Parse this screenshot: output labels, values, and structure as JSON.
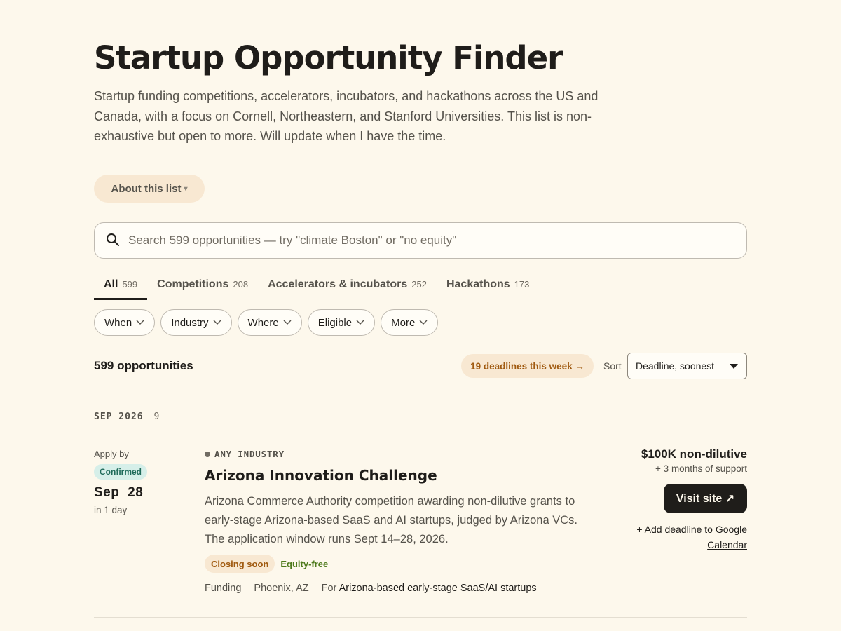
{
  "header": {
    "title": "Startup Opportunity Finder",
    "intro": "Startup funding competitions, accelerators, incubators, and hackathons across the US and Canada, with a focus on Cornell, Northeastern, and Stanford Universities. This list is non-exhaustive but open to more. Will update when I have the time.",
    "about_label": "About this list"
  },
  "search": {
    "placeholder": "Search 599 opportunities — try \"climate Boston\" or \"no equity\"",
    "value": ""
  },
  "tabs": [
    {
      "label": "All",
      "count": "599",
      "active": true
    },
    {
      "label": "Competitions",
      "count": "208",
      "active": false
    },
    {
      "label": "Accelerators & incubators",
      "count": "252",
      "active": false
    },
    {
      "label": "Hackathons",
      "count": "173",
      "active": false
    }
  ],
  "filters": [
    {
      "label": "When"
    },
    {
      "label": "Industry"
    },
    {
      "label": "Where"
    },
    {
      "label": "Eligible"
    },
    {
      "label": "More"
    }
  ],
  "results": {
    "count_label": "599 opportunities",
    "deadlines_label": "19 deadlines this week →",
    "sort_label": "Sort",
    "sort_value": "Deadline, soonest"
  },
  "group": {
    "heading": "SEP 2026",
    "count": "9"
  },
  "card": {
    "apply_by": "Apply by",
    "status": "Confirmed",
    "date": "Sep 28",
    "relative": "in 1 day",
    "industry": "ANY INDUSTRY",
    "title": "Arizona Innovation Challenge",
    "description": "Arizona Commerce Authority competition awarding non-dilutive grants to early-stage Arizona-based SaaS and AI startups, judged by Arizona VCs. The application window runs Sept 14–28, 2026.",
    "tag_closing": "Closing soon",
    "tag_equity": "Equity-free",
    "meta_type": "Funding",
    "meta_location": "Phoenix, AZ",
    "meta_for_label": "For",
    "meta_for_value": "Arizona-based early-stage SaaS/AI startups",
    "amount": "$100K non-dilutive",
    "support": "+ 3 months of support",
    "visit_label": "Visit site ↗",
    "gcal_label": "+ Add deadline to Google Calendar"
  },
  "colors": {
    "background": "#fdf8ec",
    "accent_orange": "#a05a10",
    "confirmed_green": "#1f6b5a",
    "equity_green": "#4e7a1c"
  }
}
